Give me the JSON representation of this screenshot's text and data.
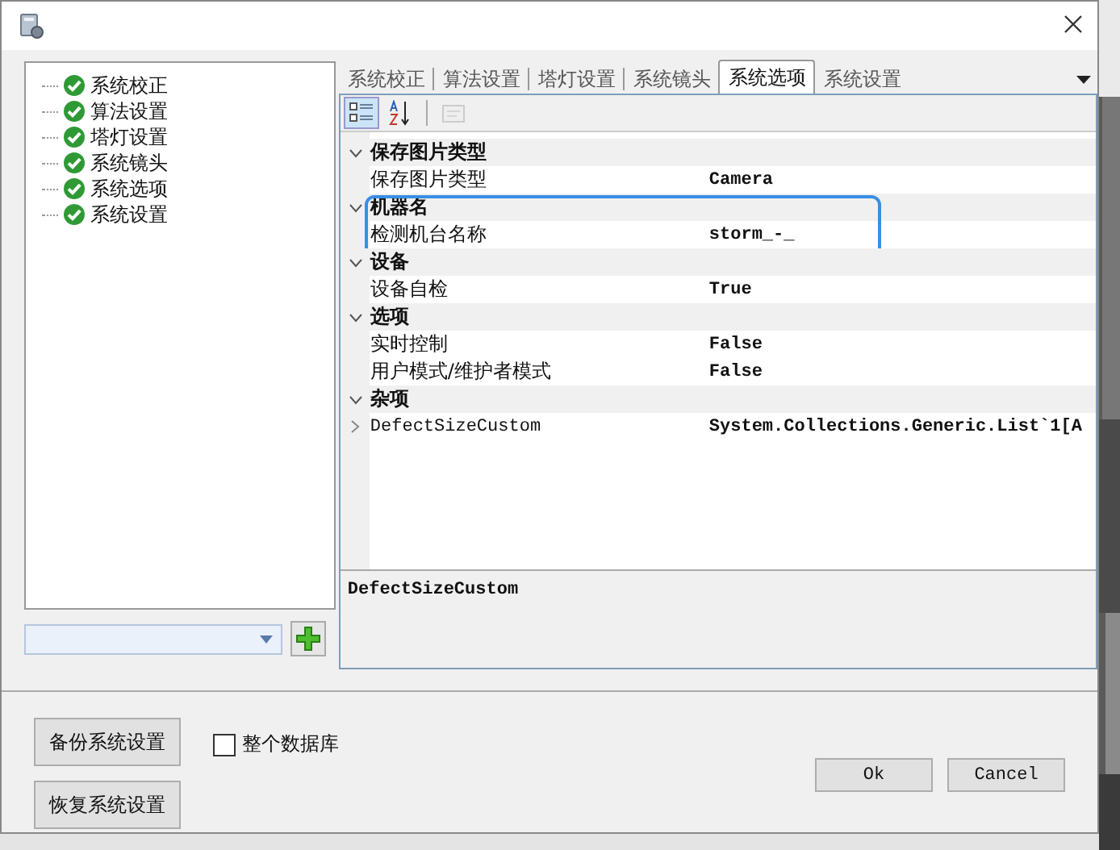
{
  "tree": {
    "items": [
      {
        "label": "系统校正"
      },
      {
        "label": "算法设置"
      },
      {
        "label": "塔灯设置"
      },
      {
        "label": "系统镜头"
      },
      {
        "label": "系统选项"
      },
      {
        "label": "系统设置"
      }
    ]
  },
  "tabs": [
    {
      "label": "系统校正",
      "selected": false
    },
    {
      "label": "算法设置",
      "selected": false
    },
    {
      "label": "塔灯设置",
      "selected": false
    },
    {
      "label": "系统镜头",
      "selected": false
    },
    {
      "label": "系统选项",
      "selected": true
    },
    {
      "label": "系统设置",
      "selected": false
    }
  ],
  "property_grid": {
    "toolbar": [
      {
        "kind": "categorized",
        "selected": true,
        "disabled": false
      },
      {
        "kind": "alphabetical",
        "selected": false,
        "disabled": false
      },
      {
        "kind": "property_pages",
        "selected": false,
        "disabled": true
      }
    ],
    "categories": [
      {
        "name": "保存图片类型",
        "expanded": true,
        "highlighted": false,
        "properties": [
          {
            "name": "保存图片类型",
            "value": "Camera",
            "expandable": false
          }
        ]
      },
      {
        "name": "机器名",
        "expanded": true,
        "highlighted": true,
        "properties": [
          {
            "name": "检测机台名称",
            "value": "storm_-_",
            "expandable": false
          }
        ]
      },
      {
        "name": "设备",
        "expanded": true,
        "highlighted": false,
        "properties": [
          {
            "name": "设备自检",
            "value": "True",
            "expandable": false
          }
        ]
      },
      {
        "name": "选项",
        "expanded": true,
        "highlighted": false,
        "properties": [
          {
            "name": "实时控制",
            "value": "False",
            "expandable": false
          },
          {
            "name": "用户模式/维护者模式",
            "value": "False",
            "expandable": false
          }
        ]
      },
      {
        "name": "杂项",
        "expanded": true,
        "highlighted": false,
        "properties": [
          {
            "name": "DefectSizeCustom",
            "value": "System.Collections.Generic.List`1[A",
            "expandable": true
          }
        ]
      }
    ],
    "description": "DefectSizeCustom"
  },
  "backup_buttons": [
    "备份系统设置",
    "恢复系统设置"
  ],
  "whole_database": {
    "label": "整个数据库",
    "checked": false
  },
  "dialog_buttons": [
    "Ok",
    "Cancel"
  ]
}
